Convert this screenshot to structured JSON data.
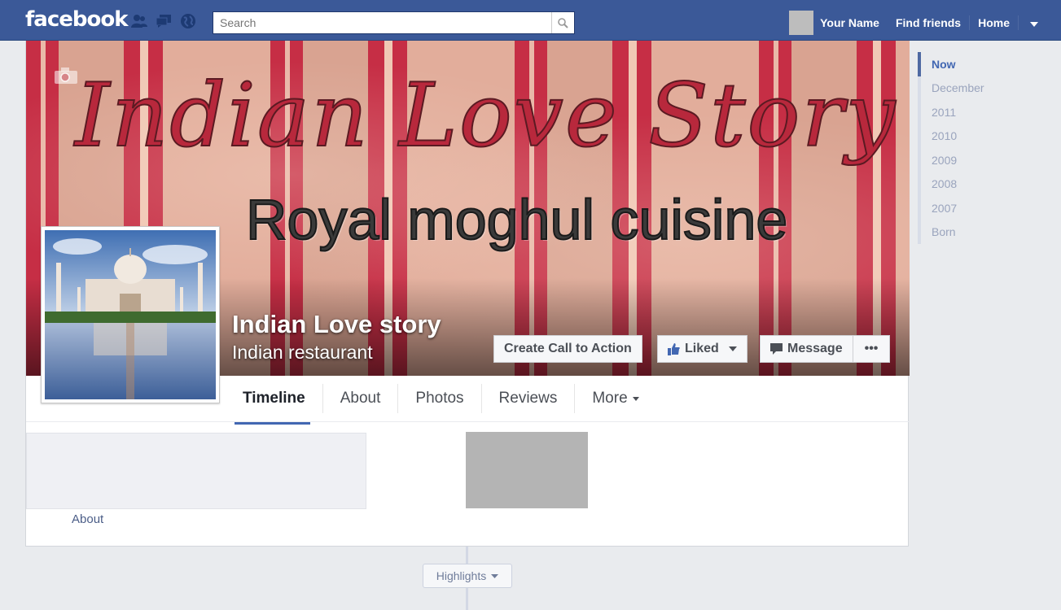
{
  "topbar": {
    "logo": "facebook",
    "search_placeholder": "Search",
    "user_name": "Your Name",
    "find_friends": "Find friends",
    "home": "Home"
  },
  "cover": {
    "script_title": "Indian Love Story",
    "subtitle": "Royal moghul cuisine"
  },
  "page": {
    "name": "Indian Love story",
    "category": "Indian restaurant"
  },
  "actions": {
    "cta": "Create Call to Action",
    "liked": "Liked",
    "message": "Message",
    "more": "•••"
  },
  "tabs": [
    "Timeline",
    "About",
    "Photos",
    "Reviews",
    "More"
  ],
  "content": {
    "about_link": "About",
    "highlights": "Highlights"
  },
  "year_nav": [
    "Now",
    "December",
    "2011",
    "2010",
    "2009",
    "2008",
    "2007",
    "Born"
  ],
  "colors": {
    "brand_blue": "#3b5998",
    "cover_red": "#c62e45"
  }
}
